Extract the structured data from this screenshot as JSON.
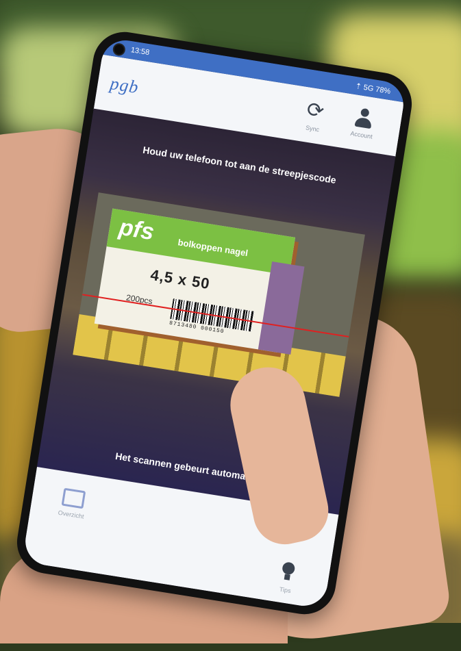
{
  "status_bar": {
    "time": "13:58",
    "indicators": "⇡ 5G 78%"
  },
  "header": {
    "logo": "pgb",
    "refresh": {
      "icon": "refresh-icon",
      "label": "Sync"
    },
    "account": {
      "icon": "person-icon",
      "label": "Account"
    }
  },
  "scanner": {
    "instruction_top": "Houd uw telefoon tot aan de streepjescode",
    "instruction_bottom": "Het scannen gebeurt automatisch"
  },
  "product": {
    "brand": "pfs",
    "subtitle": "bolkoppen nagel",
    "size": "4,5 x 50",
    "quantity": "200pcs",
    "barcode_digits": "8713480 000150"
  },
  "bottom_nav": {
    "left": {
      "icon": "screen-icon",
      "label": "Overzicht"
    },
    "right": {
      "icon": "lightbulb-icon",
      "label": "Tips"
    }
  },
  "colors": {
    "primary": "#3f6fc4",
    "scan_line": "#e02020",
    "product_green": "#7cc043"
  }
}
